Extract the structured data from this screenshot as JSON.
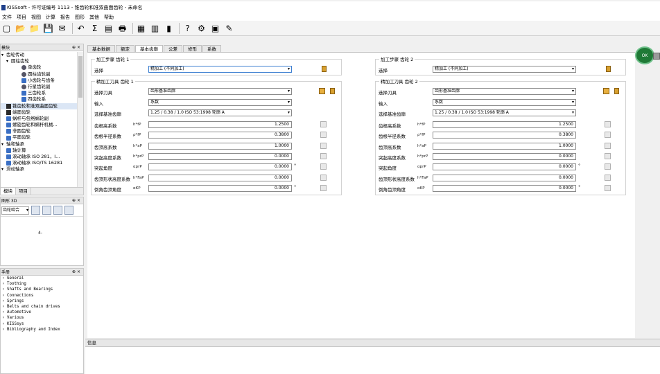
{
  "window": {
    "title": "KISSsoft - 许可证编号 1113 - 锥齿轮和准双曲面齿轮 - 未命名"
  },
  "menu": [
    "文件",
    "项目",
    "视图",
    "计算",
    "报告",
    "图形",
    "其他",
    "帮助"
  ],
  "toolbar_icons": [
    "new-file-icon",
    "open-folder-icon",
    "open-project-icon",
    "save-icon",
    "email-icon",
    "undo-icon",
    "sum-icon",
    "report-icon",
    "print-icon",
    "properties-icon",
    "calculator-icon",
    "graphic-icon",
    "help-icon",
    "settings-icon",
    "module-icon",
    "wizard-icon"
  ],
  "modules_panel": {
    "title": "模块",
    "tree": [
      {
        "label": "齿轮传动",
        "level": 0,
        "twist": "▾"
      },
      {
        "label": "圆柱齿轮",
        "level": 1,
        "twist": "▾"
      },
      {
        "label": "单齿轮",
        "level": 2,
        "icon": "gear"
      },
      {
        "label": "圆柱齿轮副",
        "level": 2,
        "icon": "gear"
      },
      {
        "label": "小齿轮与齿条",
        "level": 2,
        "icon": "blue"
      },
      {
        "label": "行星齿轮副",
        "level": 2,
        "icon": "gear"
      },
      {
        "label": "三齿轮系",
        "level": 2,
        "icon": "blue"
      },
      {
        "label": "四齿轮系",
        "level": 2,
        "icon": "blue"
      },
      {
        "label": "锥齿轮和准双曲面齿轮",
        "level": 1,
        "icon": "dark",
        "selected": true
      },
      {
        "label": "端面齿轮",
        "level": 1,
        "icon": "dark"
      },
      {
        "label": "蜗杆与包络蜗轮副",
        "level": 1,
        "icon": "blue"
      },
      {
        "label": "螺旋齿轮和蜗杆机械...",
        "level": 1,
        "icon": "blue"
      },
      {
        "label": "非圆齿轮",
        "level": 1,
        "icon": "blue"
      },
      {
        "label": "平面齿轮",
        "level": 1,
        "icon": "blue"
      },
      {
        "label": "轴和轴承",
        "level": 0,
        "twist": "▾"
      },
      {
        "label": "轴计算",
        "level": 1,
        "icon": "blue"
      },
      {
        "label": "滚动轴承 ISO 281，I...",
        "level": 1,
        "icon": "blue"
      },
      {
        "label": "滚动轴承 ISO/TS 16281",
        "level": 1,
        "icon": "blue"
      },
      {
        "label": "滑动轴承",
        "level": 0,
        "twist": "▾"
      }
    ],
    "tabs": [
      "模块",
      "项目"
    ]
  },
  "graphics_panel": {
    "title": "图形 3D",
    "select_value": "齿轮啮合",
    "canvas_mark": "4-"
  },
  "help_panel": {
    "title": "手册",
    "items": [
      "General",
      "Toothing",
      "Shafts and Bearings",
      "Connections",
      "Springs",
      "Belts and chain drives",
      "Automotive",
      "Various",
      "KISSsys",
      "Bibliography and Index"
    ]
  },
  "tabs": [
    "基本数据",
    "额定",
    "基本齿廓",
    "公差",
    "修形",
    "系数"
  ],
  "active_tab": 2,
  "gear1": {
    "step_title": "加工步骤 齿轮 1",
    "select_label": "选择",
    "select_value": "精加工 (不同加工)",
    "tool_title": "精加工刀具 齿轮 1",
    "tool_label": "选择刀具",
    "tool_value": "齿形基准齿廓",
    "input_label": "输入",
    "input_value": "系数",
    "profile_label": "选择基准齿廓",
    "profile_value": "1.25 / 0.38 / 1.0 ISO 53:1998 轮廓 A",
    "rows": [
      {
        "label": "齿根高系数",
        "symbol": "h*fP",
        "value": "1.2500",
        "unit": ""
      },
      {
        "label": "齿根半径系数",
        "symbol": "ρ*fP",
        "value": "0.3800",
        "unit": ""
      },
      {
        "label": "齿顶高系数",
        "symbol": "h*aP",
        "value": "1.0000",
        "unit": ""
      },
      {
        "label": "突起高度系数",
        "symbol": "h*prP",
        "value": "0.0000",
        "unit": ""
      },
      {
        "label": "突起角度",
        "symbol": "αprP",
        "value": "0.0000",
        "unit": "°"
      },
      {
        "label": "齿顶形状高度系数",
        "symbol": "h*FaP",
        "value": "0.0000",
        "unit": ""
      },
      {
        "label": "倒角齿顶角度",
        "symbol": "αKP",
        "value": "0.0000",
        "unit": "°"
      }
    ]
  },
  "gear2": {
    "step_title": "加工步骤 齿轮 2",
    "select_label": "选择",
    "select_value": "精加工 (不同加工)",
    "tool_title": "精加工刀具 齿轮 2",
    "tool_label": "选择刀具",
    "tool_value": "齿形基准齿廓",
    "input_label": "输入",
    "input_value": "系数",
    "profile_label": "选择基准齿廓",
    "profile_value": "1.25 / 0.38 / 1.0 ISO 53:1998 轮廓 A",
    "rows": [
      {
        "label": "齿根高系数",
        "symbol": "h*fP",
        "value": "1.2500",
        "unit": ""
      },
      {
        "label": "齿根半径系数",
        "symbol": "ρ*fP",
        "value": "0.3800",
        "unit": ""
      },
      {
        "label": "齿顶高系数",
        "symbol": "h*aP",
        "value": "1.0000",
        "unit": ""
      },
      {
        "label": "突起高度系数",
        "symbol": "h*prP",
        "value": "0.0000",
        "unit": ""
      },
      {
        "label": "突起角度",
        "symbol": "αprP",
        "value": "0.0000",
        "unit": "°"
      },
      {
        "label": "齿顶形状高度系数",
        "symbol": "h*FaP",
        "value": "0.0000",
        "unit": ""
      },
      {
        "label": "倒角齿顶角度",
        "symbol": "αKP",
        "value": "0.0000",
        "unit": "°"
      }
    ]
  },
  "status_badge": "OK",
  "info_panel": {
    "title": "信息"
  }
}
